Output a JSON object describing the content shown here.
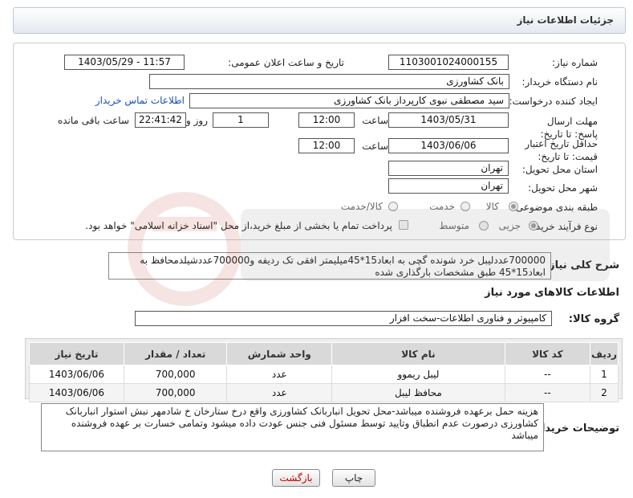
{
  "header": {
    "title": "جزئیات اطلاعات نیاز"
  },
  "form": {
    "need_number_label": "شماره نیاز:",
    "need_number": "1103001024000155",
    "announce_label": "تاریخ و ساعت اعلان عمومی:",
    "announce_value": "1403/05/29 - 11:57",
    "buyer_org_label": "نام دستگاه خریدار:",
    "buyer_org": "بانک کشاورزی",
    "requester_label": "ایجاد کننده درخواست:",
    "requester": "سید مصطفی نبوی کارپرداز بانک کشاورزی",
    "contact_link": "اطلاعات تماس خریدار",
    "send_deadline_label": "مهلت ارسال پاسخ: تا تاریخ:",
    "send_date": "1403/05/31",
    "time_label": "ساعت",
    "send_time": "12:00",
    "days": "1",
    "day_and_label": "روز و",
    "remaining_time": "22:41:42",
    "remaining_label": "ساعت باقی مانده",
    "price_validity_label": "حداقل تاریخ اعتبار قیمت: تا تاریخ:",
    "validity_date": "1403/06/06",
    "validity_time_label": "ساعت",
    "validity_time": "12:00",
    "province_label": "استان محل تحویل:",
    "province": "تهران",
    "city_label": "شهر محل تحویل:",
    "city": "تهران",
    "category_label": "طبقه بندی موضوعی:",
    "category_options": [
      "کالا",
      "خدمت",
      "کالا/خدمت"
    ],
    "process_label": "نوع فرآیند خرید :",
    "process_options": [
      "جزیی",
      "متوسط"
    ],
    "payment_note": "پرداخت تمام یا بخشی از مبلغ خرید،از محل \"اسناد خزانه اسلامی\" خواهد بود."
  },
  "summary": {
    "label": "شرح کلی نیاز:",
    "text": "700000عددلیبل خرد شونده گچی به ابعاد15*45میلیمتر افقی تک ردیفه و700000عددشیلدمحافظ به ابعاد15*45 طبق مشخصات بارگذاری شده"
  },
  "goods": {
    "section_title": "اطلاعات کالاهای مورد نیاز",
    "group_label": "گروه کالا:",
    "group_value": "کامپیوتر و فناوری اطلاعات-سخت افزار",
    "columns": [
      "ردیف",
      "کد کالا",
      "نام کالا",
      "واحد شمارش",
      "تعداد / مقدار",
      "تاریخ نیاز"
    ],
    "rows": [
      {
        "row": "1",
        "code": "--",
        "name": "لیبل ریموو",
        "unit": "عدد",
        "qty": "700,000",
        "date": "1403/06/06"
      },
      {
        "row": "2",
        "code": "--",
        "name": "محافظ لیبل",
        "unit": "عدد",
        "qty": "700,000",
        "date": "1403/06/06"
      }
    ]
  },
  "buyer_notes": {
    "label": "توضیحات خریدار:",
    "text": "هزینه حمل برعهده فروشنده میباشد-محل تحویل انباربانک کشاورزی واقع درخ ستارخان خ شادمهر نبش استوار انباربانک کشاورزی درصورت عدم انطباق وتایید توسط مسئول فنی جنس عودت داده میشود وتمامی خسارت بر عهده فروشنده میباشد"
  },
  "buttons": {
    "print": "چاپ",
    "back": "بازگشت"
  },
  "colors": {
    "link": "#1a4fb5",
    "back_button_text": "#c00000",
    "header_border": "#bfc8d3"
  }
}
